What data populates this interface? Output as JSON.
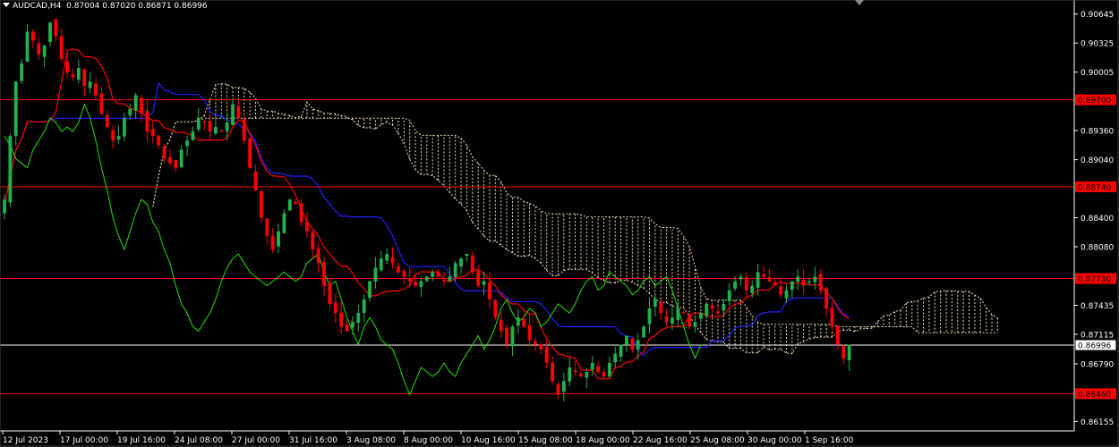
{
  "header": {
    "symbol": "AUDCAD,H4",
    "open": "0.87004",
    "high": "0.87020",
    "low": "0.86871",
    "close": "0.86996"
  },
  "chart_data": {
    "type": "candlestick",
    "ylim": [
      0.8605,
      0.908
    ],
    "y_ticks": [
      "0.90645",
      "0.90325",
      "0.90005",
      "0.89360",
      "0.89040",
      "0.88400",
      "0.88080",
      "0.87435",
      "0.87115",
      "0.86790",
      "0.86155"
    ],
    "x_ticks": [
      "12 Jul 2023",
      "17 Jul 00:00",
      "19 Jul 16:00",
      "24 Jul 08:00",
      "27 Jul 00:00",
      "31 Jul 16:00",
      "3 Aug 08:00",
      "8 Aug 00:00",
      "10 Aug 16:00",
      "15 Aug 08:00",
      "18 Aug 00:00",
      "22 Aug 16:00",
      "25 Aug 08:00",
      "30 Aug 00:00",
      "1 Sep 16:00"
    ],
    "horizontal_levels": [
      {
        "label": "0.89700",
        "value": 0.897,
        "color": "#ff0000"
      },
      {
        "label": "0.88740",
        "value": 0.8874,
        "color": "#ff0000"
      },
      {
        "label": "0.87730",
        "value": 0.8773,
        "color": "#ff0000"
      },
      {
        "label": "0.86460",
        "value": 0.8646,
        "color": "#ff0000"
      }
    ],
    "current_price": {
      "label": "0.86996",
      "value": 0.86996,
      "color": "#ffffff"
    },
    "colors": {
      "bull": "#22b14c",
      "bear": "#ff0000",
      "tenkan": "#ff0000",
      "kijun": "#2020ff",
      "chikou": "#22e000",
      "cloud": "#f5deb3",
      "axis": "#ffffff"
    },
    "close_series": [
      0.886,
      0.893,
      0.899,
      0.901,
      0.9045,
      0.9035,
      0.902,
      0.903,
      0.9055,
      0.904,
      0.9015,
      0.9,
      0.8995,
      0.9005,
      0.8985,
      0.899,
      0.8975,
      0.8955,
      0.894,
      0.8925,
      0.893,
      0.895,
      0.896,
      0.8975,
      0.8955,
      0.8935,
      0.893,
      0.892,
      0.8905,
      0.89,
      0.8895,
      0.8915,
      0.8925,
      0.8935,
      0.895,
      0.8945,
      0.8935,
      0.894,
      0.8935,
      0.8945,
      0.8965,
      0.895,
      0.8925,
      0.8895,
      0.887,
      0.884,
      0.882,
      0.8805,
      0.8825,
      0.8845,
      0.886,
      0.8855,
      0.8835,
      0.8825,
      0.8805,
      0.879,
      0.8765,
      0.8745,
      0.8735,
      0.872,
      0.8715,
      0.8725,
      0.8735,
      0.875,
      0.877,
      0.8785,
      0.8795,
      0.88,
      0.879,
      0.878,
      0.8775,
      0.877,
      0.8765,
      0.877,
      0.8775,
      0.878,
      0.8775,
      0.877,
      0.8775,
      0.879,
      0.8795,
      0.88,
      0.878,
      0.8765,
      0.877,
      0.875,
      0.873,
      0.8715,
      0.87,
      0.872,
      0.873,
      0.872,
      0.8705,
      0.87,
      0.8695,
      0.868,
      0.866,
      0.8645,
      0.866,
      0.8675,
      0.867,
      0.8665,
      0.867,
      0.868,
      0.867,
      0.8665,
      0.868,
      0.869,
      0.87,
      0.871,
      0.8695,
      0.8705,
      0.872,
      0.874,
      0.875,
      0.8735,
      0.8725,
      0.873,
      0.874,
      0.8735,
      0.872,
      0.8725,
      0.8735,
      0.8745,
      0.874,
      0.8735,
      0.8745,
      0.876,
      0.877,
      0.8775,
      0.876,
      0.8765,
      0.878,
      0.8775,
      0.877,
      0.8765,
      0.8755,
      0.876,
      0.877,
      0.8775,
      0.8765,
      0.877,
      0.8775,
      0.876,
      0.874,
      0.872,
      0.87,
      0.8685,
      0.87
    ]
  }
}
